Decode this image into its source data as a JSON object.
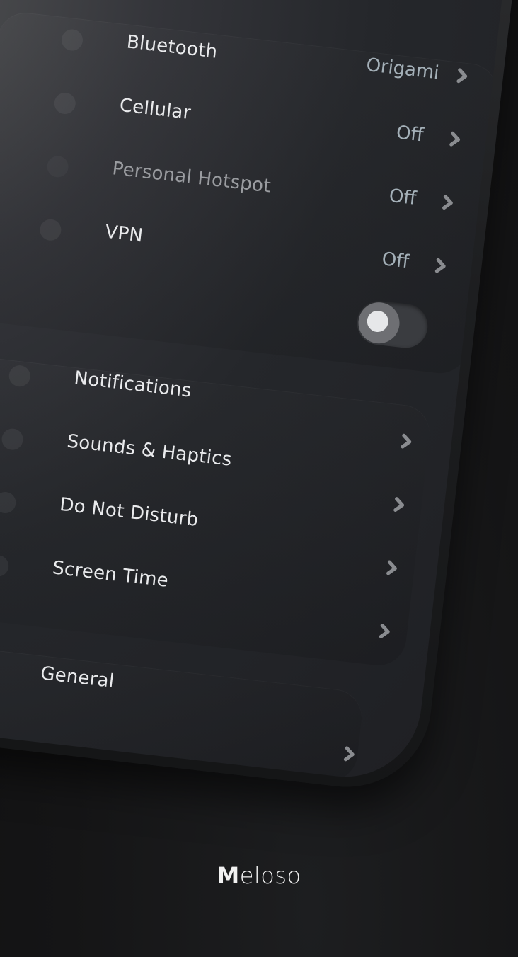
{
  "settings": {
    "rows": [
      {
        "label": "Bluetooth",
        "value": "Origami",
        "disabled": false
      },
      {
        "label": "Cellular",
        "value": "Off",
        "disabled": false
      },
      {
        "label": "Personal Hotspot",
        "value": "Off",
        "disabled": true
      },
      {
        "label": "VPN",
        "value": "Off",
        "disabled": false
      }
    ],
    "vpn_toggle": {
      "state": "off"
    },
    "group2": [
      {
        "label": "Notifications"
      },
      {
        "label": "Sounds & Haptics"
      },
      {
        "label": "Do Not Disturb"
      },
      {
        "label": "Screen Time"
      }
    ],
    "group3": [
      {
        "label": "General"
      }
    ]
  },
  "brand": {
    "bold": "M",
    "rest": "eloso"
  },
  "colors": {
    "background": "#141415",
    "screen": "#25272b",
    "text": "#e9eaec",
    "value_text": "#a4b0b8",
    "toggle_track": "#3a3c40",
    "toggle_knob": "#e6e7e9"
  }
}
